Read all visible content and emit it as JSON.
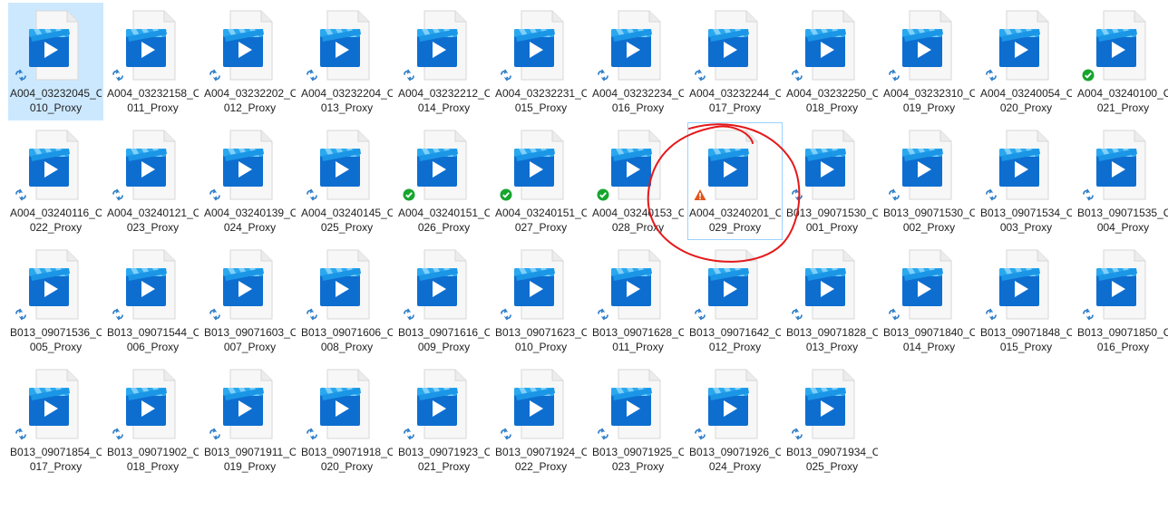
{
  "colors": {
    "selection_bg": "#cce8ff",
    "focus_border": "#99d1ff",
    "annotation": "#e4191b",
    "sync_blue": "#2f7fc8",
    "ok_green": "#17a52e",
    "warn_orange": "#e0561c"
  },
  "files": [
    {
      "line1": "A004_03232045_C",
      "line2": "010_Proxy",
      "overlay": "sync-pending-icon",
      "state": "selected"
    },
    {
      "line1": "A004_03232158_C",
      "line2": "011_Proxy",
      "overlay": "sync-pending-icon",
      "state": "normal"
    },
    {
      "line1": "A004_03232202_C",
      "line2": "012_Proxy",
      "overlay": "sync-pending-icon",
      "state": "normal"
    },
    {
      "line1": "A004_03232204_C",
      "line2": "013_Proxy",
      "overlay": "sync-pending-icon",
      "state": "normal"
    },
    {
      "line1": "A004_03232212_C",
      "line2": "014_Proxy",
      "overlay": "sync-pending-icon",
      "state": "normal"
    },
    {
      "line1": "A004_03232231_C",
      "line2": "015_Proxy",
      "overlay": "sync-pending-icon",
      "state": "normal"
    },
    {
      "line1": "A004_03232234_C",
      "line2": "016_Proxy",
      "overlay": "sync-pending-icon",
      "state": "normal"
    },
    {
      "line1": "A004_03232244_C",
      "line2": "017_Proxy",
      "overlay": "sync-pending-icon",
      "state": "normal"
    },
    {
      "line1": "A004_03232250_C",
      "line2": "018_Proxy",
      "overlay": "sync-pending-icon",
      "state": "normal"
    },
    {
      "line1": "A004_03232310_C",
      "line2": "019_Proxy",
      "overlay": "sync-pending-icon",
      "state": "normal"
    },
    {
      "line1": "A004_03240054_C",
      "line2": "020_Proxy",
      "overlay": "sync-pending-icon",
      "state": "normal"
    },
    {
      "line1": "A004_03240100_C",
      "line2": "021_Proxy",
      "overlay": "synced-check-icon",
      "state": "normal"
    },
    {
      "line1": "A004_03240116_C",
      "line2": "022_Proxy",
      "overlay": "sync-pending-icon",
      "state": "normal"
    },
    {
      "line1": "A004_03240121_C",
      "line2": "023_Proxy",
      "overlay": "sync-pending-icon",
      "state": "normal"
    },
    {
      "line1": "A004_03240139_C",
      "line2": "024_Proxy",
      "overlay": "sync-pending-icon",
      "state": "normal"
    },
    {
      "line1": "A004_03240145_C",
      "line2": "025_Proxy",
      "overlay": "sync-pending-icon",
      "state": "normal"
    },
    {
      "line1": "A004_03240151_C",
      "line2": "026_Proxy",
      "overlay": "synced-check-icon",
      "state": "normal"
    },
    {
      "line1": "A004_03240151_C",
      "line2": "027_Proxy",
      "overlay": "synced-check-icon",
      "state": "normal"
    },
    {
      "line1": "A004_03240153_C",
      "line2": "028_Proxy",
      "overlay": "synced-check-icon",
      "state": "normal"
    },
    {
      "line1": "A004_03240201_C",
      "line2": "029_Proxy",
      "overlay": "sync-warning-icon",
      "state": "focused"
    },
    {
      "line1": "B013_09071530_C",
      "line2": "001_Proxy",
      "overlay": "sync-pending-icon",
      "state": "normal"
    },
    {
      "line1": "B013_09071530_C",
      "line2": "002_Proxy",
      "overlay": "sync-pending-icon",
      "state": "normal"
    },
    {
      "line1": "B013_09071534_C",
      "line2": "003_Proxy",
      "overlay": "sync-pending-icon",
      "state": "normal"
    },
    {
      "line1": "B013_09071535_C",
      "line2": "004_Proxy",
      "overlay": "sync-pending-icon",
      "state": "normal"
    },
    {
      "line1": "B013_09071536_C",
      "line2": "005_Proxy",
      "overlay": "sync-pending-icon",
      "state": "normal"
    },
    {
      "line1": "B013_09071544_C",
      "line2": "006_Proxy",
      "overlay": "sync-pending-icon",
      "state": "normal"
    },
    {
      "line1": "B013_09071603_C",
      "line2": "007_Proxy",
      "overlay": "sync-pending-icon",
      "state": "normal"
    },
    {
      "line1": "B013_09071606_C",
      "line2": "008_Proxy",
      "overlay": "sync-pending-icon",
      "state": "normal"
    },
    {
      "line1": "B013_09071616_C",
      "line2": "009_Proxy",
      "overlay": "sync-pending-icon",
      "state": "normal"
    },
    {
      "line1": "B013_09071623_C",
      "line2": "010_Proxy",
      "overlay": "sync-pending-icon",
      "state": "normal"
    },
    {
      "line1": "B013_09071628_C",
      "line2": "011_Proxy",
      "overlay": "sync-pending-icon",
      "state": "normal"
    },
    {
      "line1": "B013_09071642_C",
      "line2": "012_Proxy",
      "overlay": "sync-pending-icon",
      "state": "normal"
    },
    {
      "line1": "B013_09071828_C",
      "line2": "013_Proxy",
      "overlay": "sync-pending-icon",
      "state": "normal"
    },
    {
      "line1": "B013_09071840_C",
      "line2": "014_Proxy",
      "overlay": "sync-pending-icon",
      "state": "normal"
    },
    {
      "line1": "B013_09071848_C",
      "line2": "015_Proxy",
      "overlay": "sync-pending-icon",
      "state": "normal"
    },
    {
      "line1": "B013_09071850_C",
      "line2": "016_Proxy",
      "overlay": "sync-pending-icon",
      "state": "normal"
    },
    {
      "line1": "B013_09071854_C",
      "line2": "017_Proxy",
      "overlay": "sync-pending-icon",
      "state": "normal"
    },
    {
      "line1": "B013_09071902_C",
      "line2": "018_Proxy",
      "overlay": "sync-pending-icon",
      "state": "normal"
    },
    {
      "line1": "B013_09071911_C",
      "line2": "019_Proxy",
      "overlay": "sync-pending-icon",
      "state": "normal"
    },
    {
      "line1": "B013_09071918_C",
      "line2": "020_Proxy",
      "overlay": "sync-pending-icon",
      "state": "normal"
    },
    {
      "line1": "B013_09071923_C",
      "line2": "021_Proxy",
      "overlay": "sync-pending-icon",
      "state": "normal"
    },
    {
      "line1": "B013_09071924_C",
      "line2": "022_Proxy",
      "overlay": "sync-pending-icon",
      "state": "normal"
    },
    {
      "line1": "B013_09071925_C",
      "line2": "023_Proxy",
      "overlay": "sync-pending-icon",
      "state": "normal"
    },
    {
      "line1": "B013_09071926_C",
      "line2": "024_Proxy",
      "overlay": "sync-pending-icon",
      "state": "normal"
    },
    {
      "line1": "B013_09071934_C",
      "line2": "025_Proxy",
      "overlay": "sync-pending-icon",
      "state": "normal"
    }
  ],
  "annotation": {
    "shape": "freehand-circle",
    "color": "#e4191b",
    "target": "A004_03240201_C029_Proxy"
  }
}
